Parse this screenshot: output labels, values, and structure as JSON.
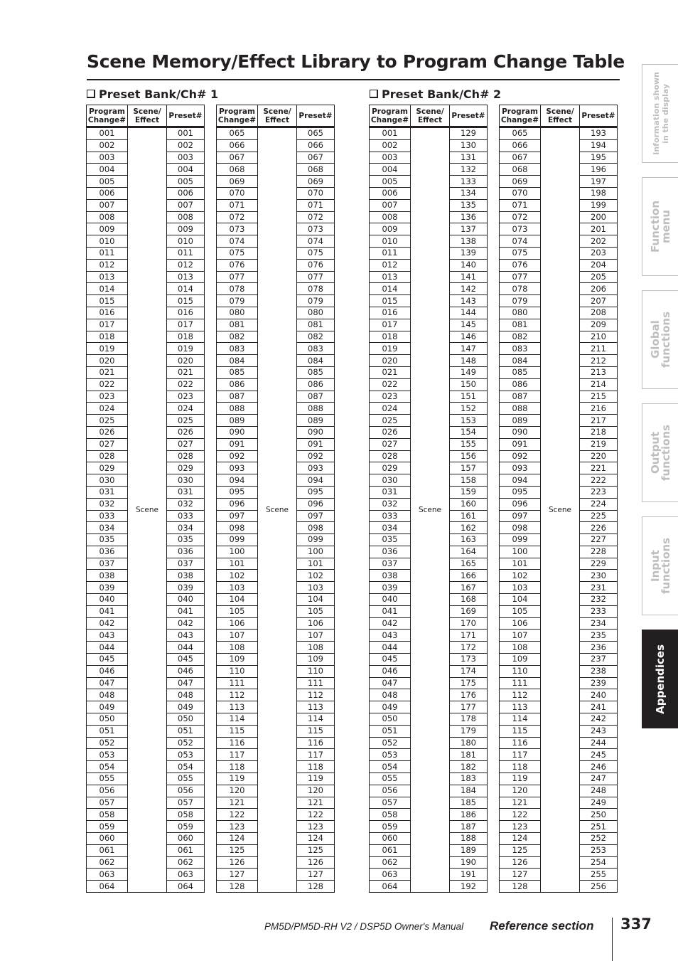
{
  "page": {
    "title": "Scene Memory/Effect Library to Program Change Table",
    "page_number": "337",
    "footer_manual": "PM5D/PM5D-RH V2 / DSP5D Owner's Manual",
    "footer_section": "Reference section"
  },
  "side_tabs": [
    {
      "label": "Information shown\nin the display",
      "active": false
    },
    {
      "label": "Function\nmenu",
      "active": false
    },
    {
      "label": "Global\nfunctions",
      "active": false
    },
    {
      "label": "Output\nfunctions",
      "active": false
    },
    {
      "label": "Input\nfunctions",
      "active": false
    },
    {
      "label": "Appendices",
      "active": true
    }
  ],
  "columns": {
    "program_change": "Program Change#",
    "scene_effect": "Scene/ Effect",
    "preset": "Preset#"
  },
  "banks": [
    {
      "heading": "Preset Bank/Ch# 1",
      "tables": [
        {
          "scene_label": "Scene",
          "program_change": [
            "001",
            "002",
            "003",
            "004",
            "005",
            "006",
            "007",
            "008",
            "009",
            "010",
            "011",
            "012",
            "013",
            "014",
            "015",
            "016",
            "017",
            "018",
            "019",
            "020",
            "021",
            "022",
            "023",
            "024",
            "025",
            "026",
            "027",
            "028",
            "029",
            "030",
            "031",
            "032",
            "033",
            "034",
            "035",
            "036",
            "037",
            "038",
            "039",
            "040",
            "041",
            "042",
            "043",
            "044",
            "045",
            "046",
            "047",
            "048",
            "049",
            "050",
            "051",
            "052",
            "053",
            "054",
            "055",
            "056",
            "057",
            "058",
            "059",
            "060",
            "061",
            "062",
            "063",
            "064"
          ],
          "preset": [
            "001",
            "002",
            "003",
            "004",
            "005",
            "006",
            "007",
            "008",
            "009",
            "010",
            "011",
            "012",
            "013",
            "014",
            "015",
            "016",
            "017",
            "018",
            "019",
            "020",
            "021",
            "022",
            "023",
            "024",
            "025",
            "026",
            "027",
            "028",
            "029",
            "030",
            "031",
            "032",
            "033",
            "034",
            "035",
            "036",
            "037",
            "038",
            "039",
            "040",
            "041",
            "042",
            "043",
            "044",
            "045",
            "046",
            "047",
            "048",
            "049",
            "050",
            "051",
            "052",
            "053",
            "054",
            "055",
            "056",
            "057",
            "058",
            "059",
            "060",
            "061",
            "062",
            "063",
            "064"
          ]
        },
        {
          "scene_label": "Scene",
          "program_change": [
            "065",
            "066",
            "067",
            "068",
            "069",
            "070",
            "071",
            "072",
            "073",
            "074",
            "075",
            "076",
            "077",
            "078",
            "079",
            "080",
            "081",
            "082",
            "083",
            "084",
            "085",
            "086",
            "087",
            "088",
            "089",
            "090",
            "091",
            "092",
            "093",
            "094",
            "095",
            "096",
            "097",
            "098",
            "099",
            "100",
            "101",
            "102",
            "103",
            "104",
            "105",
            "106",
            "107",
            "108",
            "109",
            "110",
            "111",
            "112",
            "113",
            "114",
            "115",
            "116",
            "117",
            "118",
            "119",
            "120",
            "121",
            "122",
            "123",
            "124",
            "125",
            "126",
            "127",
            "128"
          ],
          "preset": [
            "065",
            "066",
            "067",
            "068",
            "069",
            "070",
            "071",
            "072",
            "073",
            "074",
            "075",
            "076",
            "077",
            "078",
            "079",
            "080",
            "081",
            "082",
            "083",
            "084",
            "085",
            "086",
            "087",
            "088",
            "089",
            "090",
            "091",
            "092",
            "093",
            "094",
            "095",
            "096",
            "097",
            "098",
            "099",
            "100",
            "101",
            "102",
            "103",
            "104",
            "105",
            "106",
            "107",
            "108",
            "109",
            "110",
            "111",
            "112",
            "113",
            "114",
            "115",
            "116",
            "117",
            "118",
            "119",
            "120",
            "121",
            "122",
            "123",
            "124",
            "125",
            "126",
            "127",
            "128"
          ]
        }
      ]
    },
    {
      "heading": "Preset Bank/Ch# 2",
      "tables": [
        {
          "scene_label": "Scene",
          "program_change": [
            "001",
            "002",
            "003",
            "004",
            "005",
            "006",
            "007",
            "008",
            "009",
            "010",
            "011",
            "012",
            "013",
            "014",
            "015",
            "016",
            "017",
            "018",
            "019",
            "020",
            "021",
            "022",
            "023",
            "024",
            "025",
            "026",
            "027",
            "028",
            "029",
            "030",
            "031",
            "032",
            "033",
            "034",
            "035",
            "036",
            "037",
            "038",
            "039",
            "040",
            "041",
            "042",
            "043",
            "044",
            "045",
            "046",
            "047",
            "048",
            "049",
            "050",
            "051",
            "052",
            "053",
            "054",
            "055",
            "056",
            "057",
            "058",
            "059",
            "060",
            "061",
            "062",
            "063",
            "064"
          ],
          "preset": [
            "129",
            "130",
            "131",
            "132",
            "133",
            "134",
            "135",
            "136",
            "137",
            "138",
            "139",
            "140",
            "141",
            "142",
            "143",
            "144",
            "145",
            "146",
            "147",
            "148",
            "149",
            "150",
            "151",
            "152",
            "153",
            "154",
            "155",
            "156",
            "157",
            "158",
            "159",
            "160",
            "161",
            "162",
            "163",
            "164",
            "165",
            "166",
            "167",
            "168",
            "169",
            "170",
            "171",
            "172",
            "173",
            "174",
            "175",
            "176",
            "177",
            "178",
            "179",
            "180",
            "181",
            "182",
            "183",
            "184",
            "185",
            "186",
            "187",
            "188",
            "189",
            "190",
            "191",
            "192"
          ]
        },
        {
          "scene_label": "Scene",
          "program_change": [
            "065",
            "066",
            "067",
            "068",
            "069",
            "070",
            "071",
            "072",
            "073",
            "074",
            "075",
            "076",
            "077",
            "078",
            "079",
            "080",
            "081",
            "082",
            "083",
            "084",
            "085",
            "086",
            "087",
            "088",
            "089",
            "090",
            "091",
            "092",
            "093",
            "094",
            "095",
            "096",
            "097",
            "098",
            "099",
            "100",
            "101",
            "102",
            "103",
            "104",
            "105",
            "106",
            "107",
            "108",
            "109",
            "110",
            "111",
            "112",
            "113",
            "114",
            "115",
            "116",
            "117",
            "118",
            "119",
            "120",
            "121",
            "122",
            "123",
            "124",
            "125",
            "126",
            "127",
            "128"
          ],
          "preset": [
            "193",
            "194",
            "195",
            "196",
            "197",
            "198",
            "199",
            "200",
            "201",
            "202",
            "203",
            "204",
            "205",
            "206",
            "207",
            "208",
            "209",
            "210",
            "211",
            "212",
            "213",
            "214",
            "215",
            "216",
            "217",
            "218",
            "219",
            "220",
            "221",
            "222",
            "223",
            "224",
            "225",
            "226",
            "227",
            "228",
            "229",
            "230",
            "231",
            "232",
            "233",
            "234",
            "235",
            "236",
            "237",
            "238",
            "239",
            "240",
            "241",
            "242",
            "243",
            "244",
            "245",
            "246",
            "247",
            "248",
            "249",
            "250",
            "251",
            "252",
            "253",
            "254",
            "255",
            "256"
          ]
        }
      ]
    }
  ]
}
